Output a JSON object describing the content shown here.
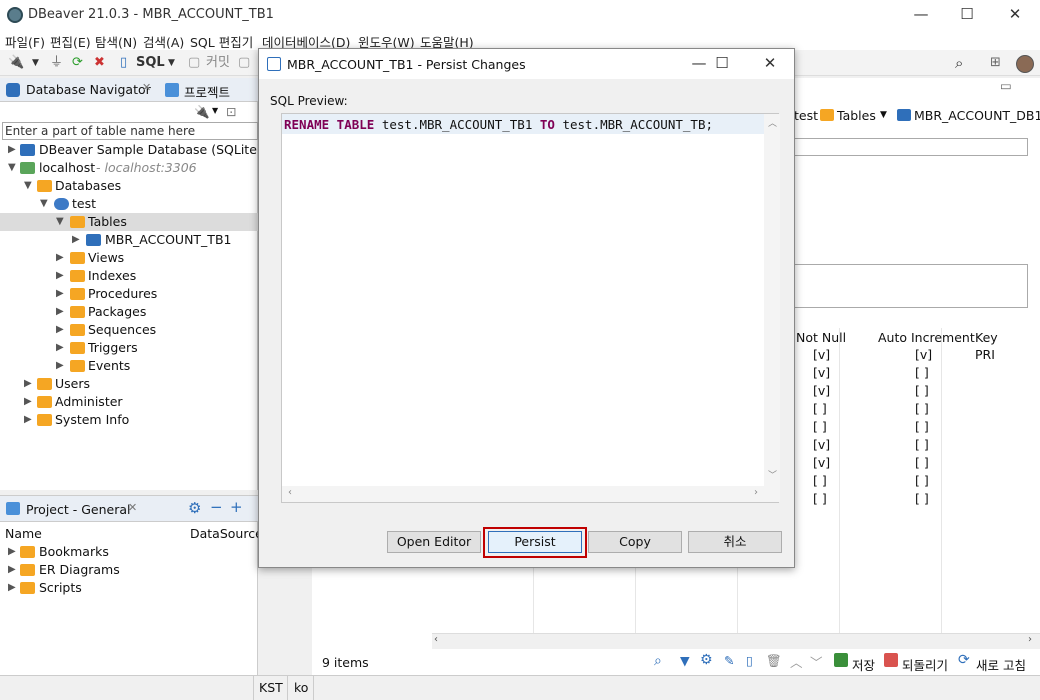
{
  "window": {
    "title": "DBeaver 21.0.3 - MBR_ACCOUNT_TB1",
    "minimize": "—",
    "maximize": "☐",
    "close": "✕"
  },
  "menu": [
    "파일(F)",
    "편집(E)",
    "탐색(N)",
    "검색(A)",
    "SQL 편집기",
    "데이터베이스(D)",
    "윈도우(W)",
    "도움말(H)"
  ],
  "toolbar": {
    "sql": "SQL",
    "commit": "커밋"
  },
  "navigator": {
    "tab_label": "Database Navigator",
    "project_tab_short": "프로젝트",
    "filter_placeholder": "Enter a part of table name here",
    "items": [
      {
        "label": "DBeaver Sample Database (SQLite)",
        "sub": ""
      },
      {
        "label": "localhost",
        "sub": "- localhost:3306"
      },
      {
        "label": "Databases",
        "sub": ""
      },
      {
        "label": "test",
        "sub": ""
      },
      {
        "label": "Tables",
        "sub": ""
      },
      {
        "label": "MBR_ACCOUNT_TB1",
        "sub": ""
      },
      {
        "label": "Views",
        "sub": ""
      },
      {
        "label": "Indexes",
        "sub": ""
      },
      {
        "label": "Procedures",
        "sub": ""
      },
      {
        "label": "Packages",
        "sub": ""
      },
      {
        "label": "Sequences",
        "sub": ""
      },
      {
        "label": "Triggers",
        "sub": ""
      },
      {
        "label": "Events",
        "sub": ""
      },
      {
        "label": "Users",
        "sub": ""
      },
      {
        "label": "Administer",
        "sub": ""
      },
      {
        "label": "System Info",
        "sub": ""
      }
    ]
  },
  "project": {
    "tab_label": "Project - General",
    "col_name": "Name",
    "col_datasource": "DataSource",
    "items": [
      "Bookmarks",
      "ER Diagrams",
      "Scripts"
    ]
  },
  "editor": {
    "breadcrumb": [
      "test",
      "Tables",
      "MBR_ACCOUNT_DB1"
    ],
    "columns": [
      "Not Null",
      "Auto Increment",
      "Key"
    ],
    "rows": [
      [
        "[v]",
        "[v]",
        "PRI"
      ],
      [
        "[v]",
        "[ ]",
        ""
      ],
      [
        "[v]",
        "[ ]",
        ""
      ],
      [
        "[ ]",
        "[ ]",
        ""
      ],
      [
        "[ ]",
        "[ ]",
        ""
      ],
      [
        "[v]",
        "[ ]",
        ""
      ],
      [
        "[v]",
        "[ ]",
        ""
      ],
      [
        "[ ]",
        "[ ]",
        ""
      ],
      [
        "[ ]",
        "[ ]",
        ""
      ]
    ],
    "items_count": "9 items",
    "save": "저장",
    "revert": "되돌리기",
    "refresh": "새로 고침"
  },
  "status": {
    "tz": "KST",
    "locale": "ko"
  },
  "dialog": {
    "title": "MBR_ACCOUNT_TB1 - Persist Changes",
    "sql_label": "SQL Preview:",
    "sql": {
      "kw1": "RENAME TABLE",
      "mid": " test.MBR_ACCOUNT_TB1 ",
      "kw2": "TO",
      "tail": " test.MBR_ACCOUNT_TB;"
    },
    "buttons": {
      "open_editor": "Open Editor",
      "persist": "Persist",
      "copy": "Copy",
      "cancel": "취소"
    }
  },
  "colors": {
    "accent": "#2f6fba",
    "highlight": "#c00000",
    "keyword": "#7f0055",
    "folder": "#f5a623"
  }
}
